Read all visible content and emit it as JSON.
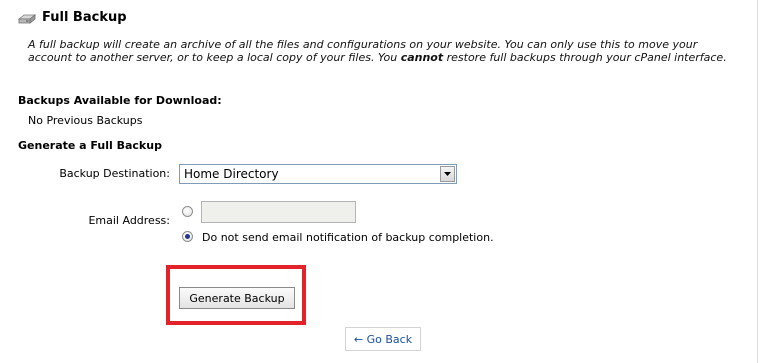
{
  "header": {
    "icon": "hard-drive-icon",
    "title": "Full Backup"
  },
  "description": {
    "part1": "A full backup will create an archive of all the files and configurations on your website. You can only use this to move your account to another server, or to keep a local copy of your files. You ",
    "emphasis": "cannot",
    "part2": " restore full backups through your cPanel interface."
  },
  "available": {
    "heading": "Backups Available for Download:",
    "empty_text": "No Previous Backups"
  },
  "generate": {
    "heading": "Generate a Full Backup",
    "destination_label": "Backup Destination:",
    "destination_value": "Home Directory",
    "email_label": "Email Address:",
    "email_value": "",
    "no_email_label": "Do not send email notification of backup completion.",
    "selected_option": "no_email",
    "button_label": "Generate Backup"
  },
  "navigation": {
    "go_back_label": "← Go Back"
  },
  "colors": {
    "highlight": "#e3232a",
    "link": "#1a4f9c"
  }
}
